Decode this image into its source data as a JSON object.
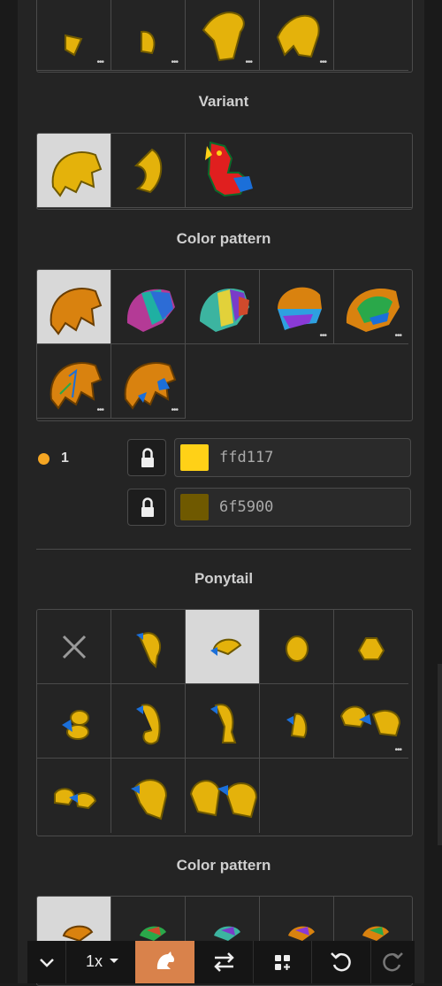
{
  "sections": {
    "variant_title": "Variant",
    "color_pattern_title_1": "Color pattern",
    "ponytail_title": "Ponytail",
    "color_pattern_title_2": "Color pattern"
  },
  "colors": {
    "index": "1",
    "fill": {
      "hex": "ffd117",
      "swatch": "#ffd117"
    },
    "outline": {
      "hex": "6f5900",
      "swatch": "#6f5900"
    }
  },
  "toolbar": {
    "zoom": "1x",
    "icons": [
      "chevron-down-icon",
      "pony-icon",
      "swap-icon",
      "add-layout-icon",
      "undo-icon",
      "redo-icon"
    ]
  },
  "theme": {
    "accent": "#d9824b",
    "hair": "#e4b20b",
    "hair_dark": "#c08d00",
    "bow": "#1b6fd9"
  }
}
